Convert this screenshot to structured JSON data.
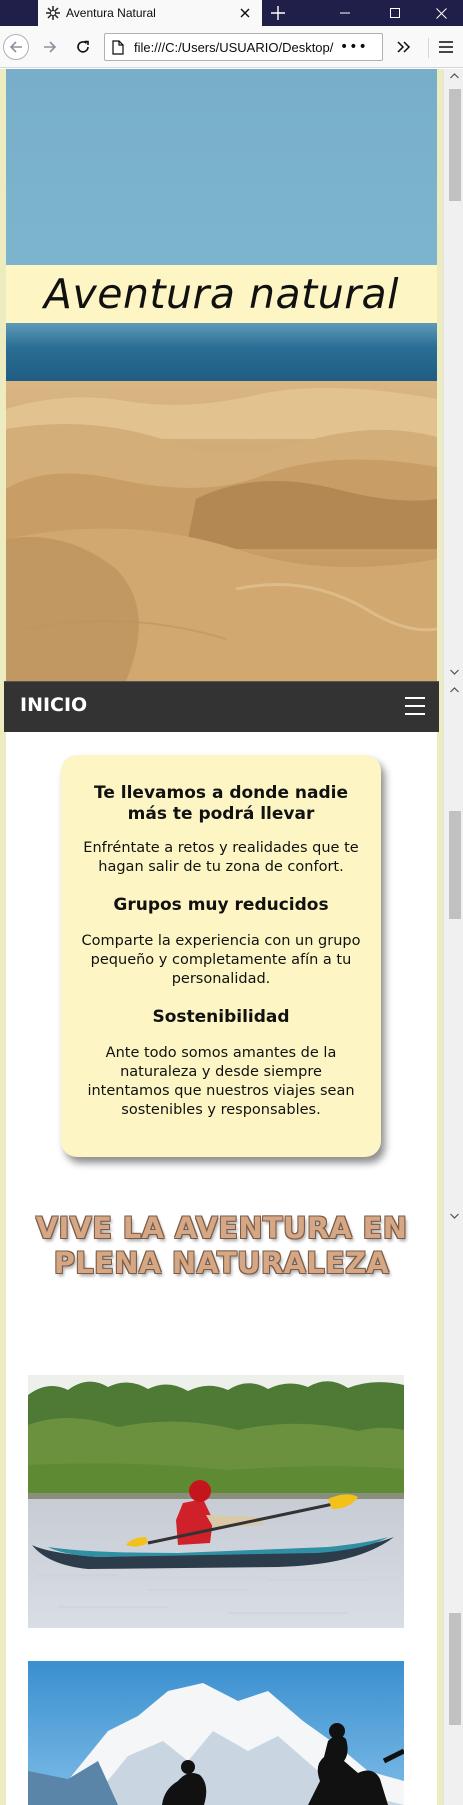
{
  "browser": {
    "tab_title": "Aventura Natural",
    "url": "file:///C:/Users/USUARIO/Desktop/e",
    "url_more": "•••",
    "window_title_icons": [
      "favicon-icon",
      "close-icon",
      "plus-icon",
      "minimize-icon",
      "maximize-icon",
      "window-close-icon"
    ],
    "toolbar_icons": [
      "back-arrow-icon",
      "forward-arrow-icon",
      "reload-icon",
      "page-icon",
      "overflow-chevrons-icon",
      "hamburger-menu-icon"
    ]
  },
  "hero": {
    "title": "Aventura natural"
  },
  "nav": {
    "home": "INICIO",
    "menu_icon": "hamburger-icon"
  },
  "card": {
    "heading1": "Te llevamos a donde nadie más te podrá llevar",
    "text1": "Enfréntate a retos y realidades que te hagan salir de tu zona de confort.",
    "heading2": "Grupos muy reducidos",
    "text2": "Comparte la experiencia con un grupo pequeño y completamente afín a tu personalidad.",
    "heading3": "Sostenibilidad",
    "text3": "Ante todo somos amantes de la naturaleza y desde siempre intentamos que nuestros viajes sean sostenibles y responsables."
  },
  "banner": {
    "text": "VIVE LA AVENTURA EN PLENA NATURALEZA"
  },
  "colors": {
    "titlebar": "#1f1f49",
    "page_border": "#edecc0",
    "card_bg": "#fdf6c4",
    "nav_bg": "#333333",
    "banner_text": "#d6a784"
  }
}
